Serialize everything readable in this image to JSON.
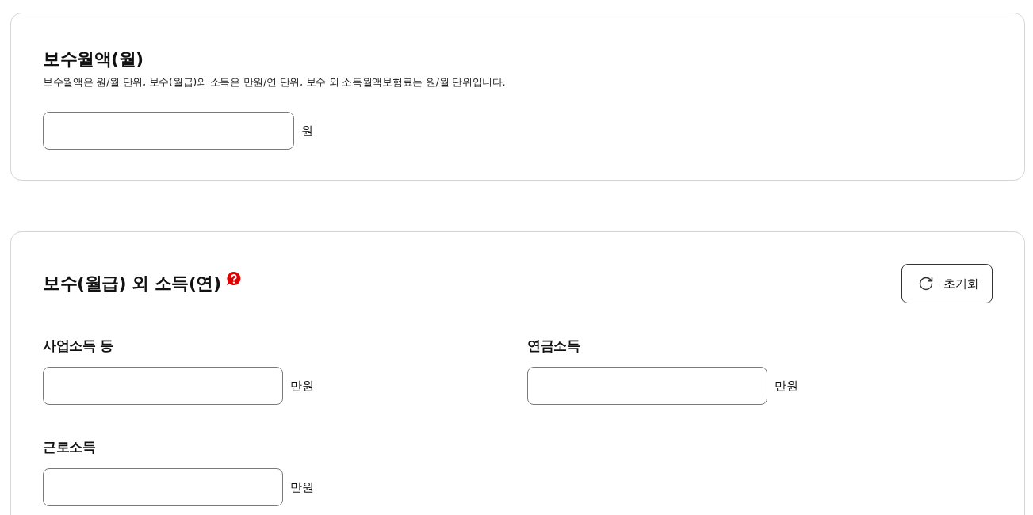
{
  "sections": [
    {
      "title": "보수월액(월)",
      "help": false,
      "description": "보수월액은 원/월 단위, 보수(월급)외 소득은 만원/연 단위, 보수 외 소득월액보험료는 원/월 단위입니다.",
      "fields": [
        {
          "unit": "원"
        }
      ]
    },
    {
      "title": "보수(월급) 외 소득(연)",
      "help": true,
      "reset_button": {
        "label": "초기화"
      },
      "fields": [
        {
          "label": "사업소득 등",
          "unit": "만원"
        },
        {
          "label": "연금소득",
          "unit": "만원"
        },
        {
          "label": "근로소득",
          "unit": "만원"
        }
      ]
    }
  ]
}
